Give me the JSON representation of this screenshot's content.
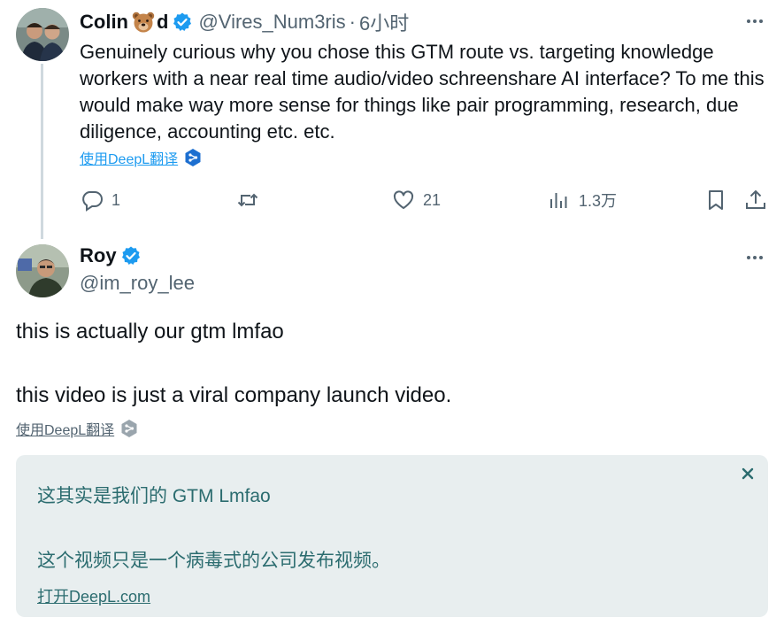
{
  "tweet1": {
    "author_name": "Colin",
    "name_suffix": "d",
    "name_emoji": "bear-face",
    "handle": "@Vires_Num3ris",
    "separator": "·",
    "time": "6小时",
    "text": "Genuinely curious why you chose this GTM route vs. targeting knowledge workers with a near real time audio/video schreenshare AI interface? To me this would make way more sense for things like pair programming, research, due diligence, accounting etc. etc.",
    "translate_label": "使用DeepL翻译",
    "stats": {
      "replies": "1",
      "likes": "21",
      "views": "1.3万"
    }
  },
  "tweet2": {
    "author_name": "Roy",
    "handle": "@im_roy_lee",
    "body_lines": [
      "this is actually our gtm lmfao",
      "this video is just a viral company launch video."
    ],
    "translate_label": "使用DeepL翻译",
    "translation": {
      "lines": [
        "这其实是我们的 GTM Lmfao",
        "这个视频只是一个病毒式的公司发布视频。"
      ],
      "open_link": "打开DeepL.com"
    }
  },
  "colors": {
    "accent": "#1d9bf0",
    "muted": "#536471",
    "text": "#0f1419",
    "translation_text": "#2b6c6f",
    "translation_bg": "#e8eeef"
  },
  "icons": [
    "more-icon",
    "verified-icon",
    "reply-icon",
    "retweet-icon",
    "like-icon",
    "views-icon",
    "bookmark-icon",
    "share-icon",
    "deepl-icon",
    "close-icon"
  ]
}
